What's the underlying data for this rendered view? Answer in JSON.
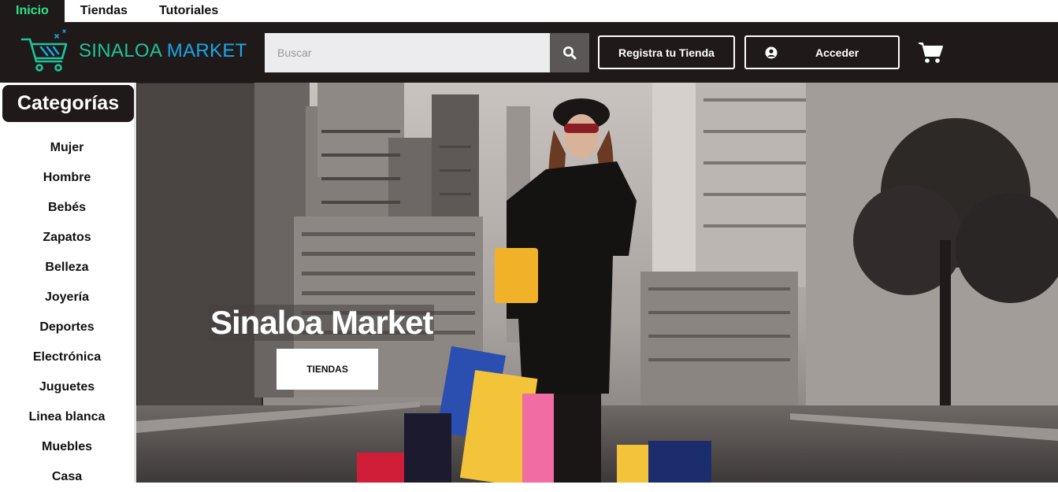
{
  "topnav": {
    "tabs": [
      {
        "label": "Inicio",
        "active": true
      },
      {
        "label": "Tiendas",
        "active": false
      },
      {
        "label": "Tutoriales",
        "active": false
      }
    ]
  },
  "header": {
    "brand_part1": "SINALOA",
    "brand_part2": " MARKET",
    "logo_icon": "shopping-cart-logo-icon",
    "search": {
      "placeholder": "Buscar",
      "value": "",
      "icon": "search-icon"
    },
    "registra_label": "Registra tu Tienda",
    "acceder_label": "Acceder",
    "acceder_icon": "user-circle-icon",
    "cart_icon": "cart-icon"
  },
  "sidebar": {
    "title": "Categorías",
    "items": [
      "Mujer",
      "Hombre",
      "Bebés",
      "Zapatos",
      "Belleza",
      "Joyería",
      "Deportes",
      "Electrónica",
      "Juguetes",
      "Linea blanca",
      "Muebles",
      "Casa"
    ]
  },
  "hero": {
    "title": "Sinaloa Market",
    "button_label": "TIENDAS"
  },
  "colors": {
    "accent_green": "#2fe38c",
    "header_bg": "#1f1a19",
    "brand_teal": "#1fc39a",
    "brand_blue": "#1aa6e6"
  }
}
